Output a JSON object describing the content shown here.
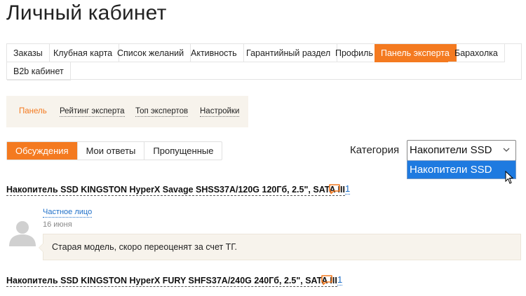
{
  "page_title": "Личный кабинет",
  "main_tabs": [
    {
      "label": "Заказы",
      "active": false
    },
    {
      "label": "Клубная карта",
      "active": false
    },
    {
      "label": "Список желаний",
      "active": false
    },
    {
      "label": "Активность",
      "active": false
    },
    {
      "label": "Гарантийный раздел",
      "active": false
    },
    {
      "label": "Профиль",
      "active": false
    },
    {
      "label": "Панель эксперта",
      "active": true
    },
    {
      "label": "Барахолка",
      "active": false
    },
    {
      "label": "B2b кабинет",
      "active": false
    }
  ],
  "sub_nav": [
    {
      "label": "Панель",
      "active": true
    },
    {
      "label": "Рейтинг эксперта",
      "active": false
    },
    {
      "label": "Топ экспертов",
      "active": false
    },
    {
      "label": "Настройки",
      "active": false
    }
  ],
  "filter_tabs": [
    {
      "label": "Обсуждения",
      "active": true
    },
    {
      "label": "Мои ответы",
      "active": false
    },
    {
      "label": "Пропущенные",
      "active": false
    }
  ],
  "category": {
    "label": "Категория",
    "selected": "Накопители SSD",
    "options": [
      "Накопители SSD"
    ]
  },
  "topics": [
    {
      "title": "Накопитель SSD KINGSTON HyperX Savage SHSS37A/120G 120Гб, 2.5\", SATA III",
      "comment_count": "1",
      "comment": {
        "author": "Частное лицо",
        "date": "16 июня",
        "text": "Старая модель, скоро переоценят за счет ТГ."
      }
    },
    {
      "title": "Накопитель SSD KINGSTON HyperX FURY SHFS37A/240G 240Гб, 2.5\", SATA III",
      "comment_count": "1"
    }
  ],
  "colors": {
    "accent": "#f47a20",
    "link": "#1e6fc8",
    "panel_bg": "#f7f3ec",
    "select_highlight": "#1e7ae0"
  }
}
